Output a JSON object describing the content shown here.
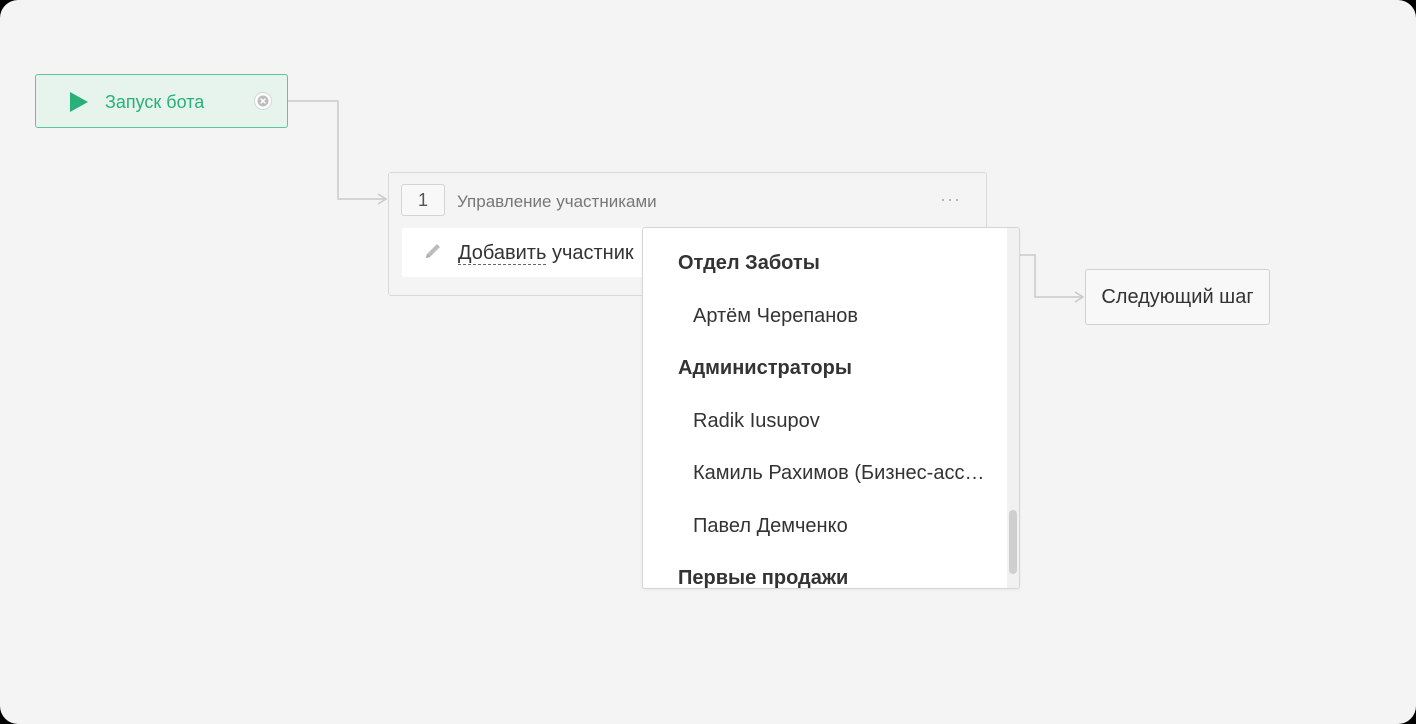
{
  "flow": {
    "start_node": {
      "label": "Запуск бота",
      "icon": "play-icon",
      "close_icon": "close-icon",
      "color": "#27b178",
      "background": "#e6f4ed",
      "border_color": "#5cc79a"
    },
    "step": {
      "number": "1",
      "title": "Управление участниками",
      "more_icon": "more-icon",
      "action_icon": "pencil-icon",
      "action_link": "Добавить",
      "action_rest": " участник"
    },
    "next_node": {
      "label": "Следующий шаг"
    }
  },
  "dropdown": {
    "groups": [
      {
        "title": "Отдел Заботы",
        "items": [
          "Артём Черепанов"
        ]
      },
      {
        "title": "Администраторы",
        "items": [
          "Radik Iusupov",
          "Камиль Рахимов (Бизнес-асс…",
          "Павел Демченко"
        ]
      },
      {
        "title": "Первые продажи",
        "items": []
      }
    ]
  },
  "colors": {
    "canvas": "#f4f4f4",
    "connector": "#c9c9c9",
    "scrollbar": "#cfcfcf"
  }
}
